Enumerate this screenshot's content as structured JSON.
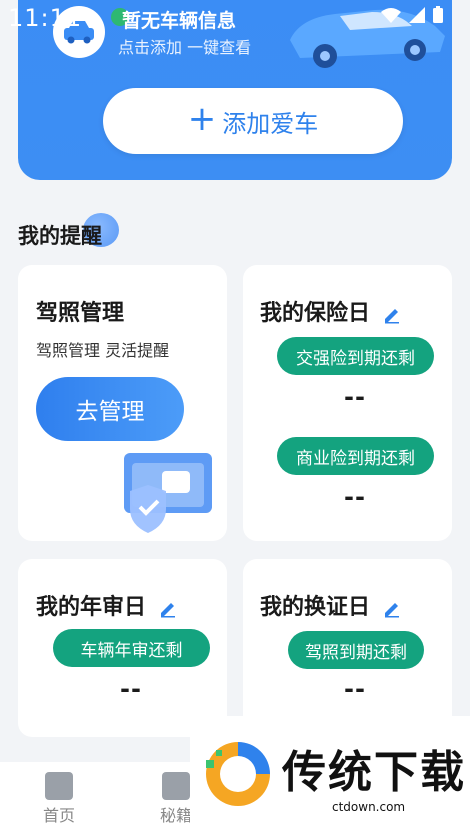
{
  "status_bar": {
    "time": "11:11"
  },
  "vehicle": {
    "title": "暂无车辆信息",
    "subtitle": "点击添加 一键查看",
    "add_button": {
      "icon": "plus-icon",
      "label": "添加爱车"
    }
  },
  "reminders": {
    "section_title": "我的提醒",
    "license": {
      "title": "驾照管理",
      "subtitle": "驾照管理 灵活提醒",
      "button": "去管理"
    },
    "insurance": {
      "title": "我的保险日",
      "items": [
        {
          "label": "交强险到期还剩",
          "value": "--"
        },
        {
          "label": "商业险到期还剩",
          "value": "--"
        }
      ]
    },
    "inspection": {
      "title": "我的年审日",
      "label": "车辆年审还剩",
      "value": "--"
    },
    "renewal": {
      "title": "我的换证日",
      "label": "驾照到期还剩",
      "value": "--"
    }
  },
  "bottom_nav": [
    {
      "label": "首页",
      "icon": "home-book-icon"
    },
    {
      "label": "秘籍",
      "icon": "star-book-icon"
    }
  ],
  "watermark": {
    "text": "传统下载",
    "url": "ctdown.com"
  },
  "colors": {
    "primary_blue": "#3b8df5",
    "pill_green": "#14a37f",
    "background": "#f2f4f7"
  }
}
